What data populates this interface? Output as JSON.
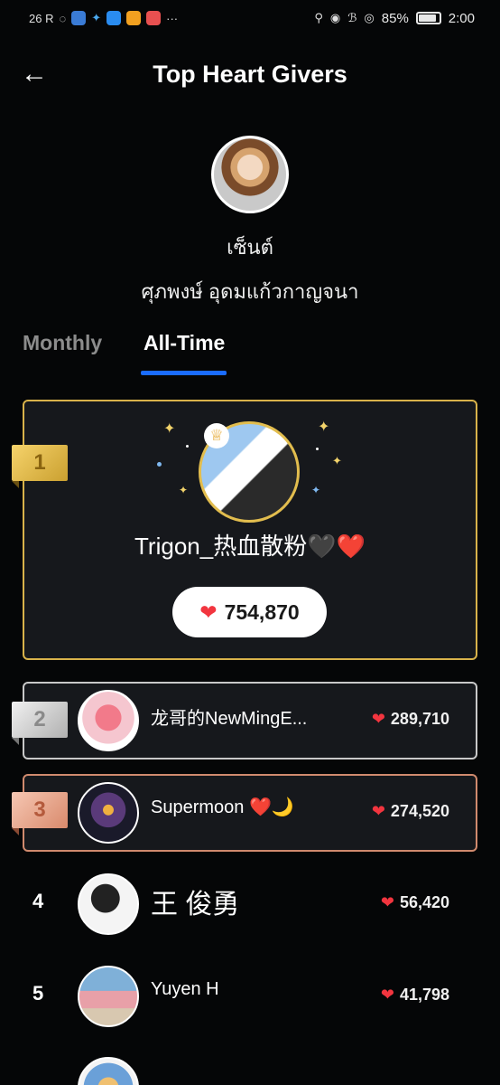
{
  "status_bar": {
    "network": "26 R",
    "battery": "85%",
    "time": "2:00",
    "more": "···"
  },
  "header": {
    "title": "Top Heart Givers"
  },
  "profile": {
    "name": "เซ็นต์",
    "fullname": "ศุภพงษ์ อุดมแก้วกาญจนา"
  },
  "tabs": [
    {
      "label": "Monthly",
      "active": false
    },
    {
      "label": "All-Time",
      "active": true
    }
  ],
  "colors": {
    "accent": "#1a6cff",
    "gold": "#d8b24a",
    "silver": "#c8c8c8",
    "bronze": "#d08a6e",
    "heart": "#f2353f"
  },
  "leaderboard": [
    {
      "rank": "1",
      "name": "Trigon_热血散粉🖤❤️",
      "score": "754,870"
    },
    {
      "rank": "2",
      "name": "龙哥的NewMingE...",
      "score": "289,710"
    },
    {
      "rank": "3",
      "name": "Supermoon ❤️🌙",
      "score": "274,520"
    },
    {
      "rank": "4",
      "name": "王 俊勇",
      "score": "56,420"
    },
    {
      "rank": "5",
      "name": "Yuyen H",
      "score": "41,798"
    }
  ]
}
